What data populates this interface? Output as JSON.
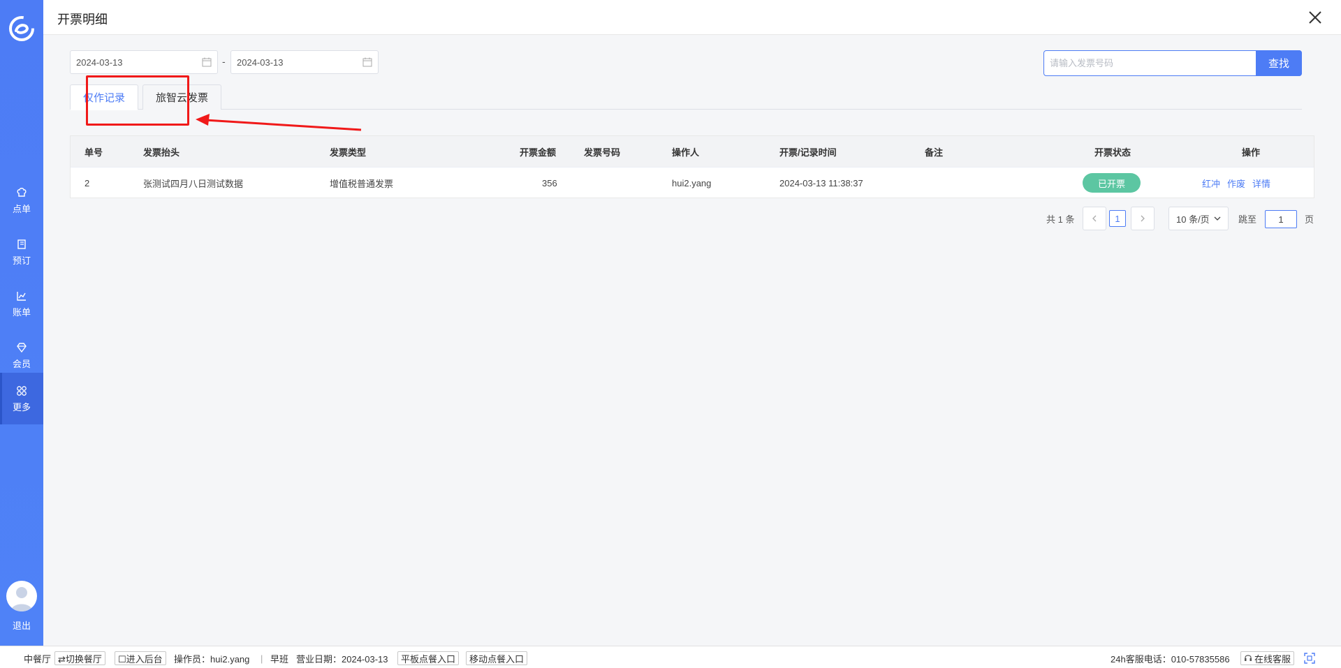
{
  "sidebar": {
    "items": [
      {
        "label": "点单",
        "icon": "chef-hat-icon"
      },
      {
        "label": "预订",
        "icon": "book-icon"
      },
      {
        "label": "账单",
        "icon": "chart-icon"
      },
      {
        "label": "会员",
        "icon": "diamond-icon"
      },
      {
        "label": "更多",
        "icon": "grid-icon",
        "active": true
      }
    ],
    "logout_label": "退出"
  },
  "header": {
    "title": "开票明细"
  },
  "filters": {
    "start_date": "2024-03-13",
    "end_date": "2024-03-13",
    "date_separator": "-",
    "search_placeholder": "请输入发票号码",
    "search_button": "查找"
  },
  "tabs": [
    {
      "label": "仅作记录",
      "active": true
    },
    {
      "label": "旅智云发票",
      "active": false
    }
  ],
  "table": {
    "columns": [
      "单号",
      "发票抬头",
      "发票类型",
      "开票金额",
      "发票号码",
      "操作人",
      "开票/记录时间",
      "备注",
      "开票状态",
      "操作"
    ],
    "rows": [
      {
        "id": "2",
        "title": "张测试四月八日测试数据",
        "type": "增值税普通发票",
        "amount": "356",
        "invoice_no": "",
        "operator": "hui2.yang",
        "time": "2024-03-13 11:38:37",
        "remark": "",
        "status": "已开票",
        "actions": [
          "红冲",
          "作废",
          "详情"
        ]
      }
    ]
  },
  "pagination": {
    "total": "共 1 条",
    "current_page": "1",
    "page_size": "10 条/页",
    "jump_label": "跳至",
    "jump_value": "1",
    "page_label": "页"
  },
  "footer": {
    "restaurant": "中餐厅",
    "switch_restaurant": "⇄切换餐厅",
    "enter_backend": "☐进入后台",
    "operator": "操作员：hui2.yang",
    "separator": "|",
    "shift": "早班",
    "business_date": "营业日期：2024-03-13",
    "tablet_order": "平板点餐入口",
    "mobile_order": "移动点餐入口",
    "hotline": "24h客服电话：010-57835586",
    "online_service": "在线客服"
  },
  "colors": {
    "accent": "#4d7cf5",
    "status_done": "#5cc6a2",
    "annotation": "#f01919"
  }
}
